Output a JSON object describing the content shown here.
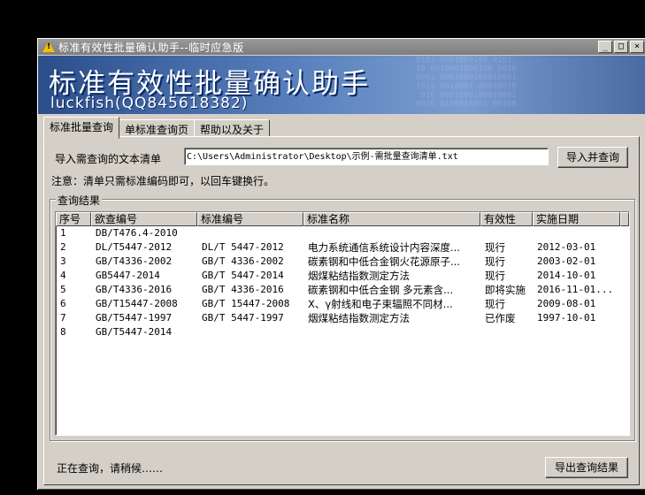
{
  "window": {
    "title": "标准有效性批量确认助手--临时应急版",
    "buttons": {
      "minimize": "_",
      "maximize": "□",
      "close": "×"
    }
  },
  "banner": {
    "title": "标准有效性批量确认助手",
    "subtitle": "luckfish(QQ845618382)"
  },
  "tabs": [
    {
      "label": "标准批量查询",
      "active": true
    },
    {
      "label": "单标准查询页",
      "active": false
    },
    {
      "label": "帮助以及关于",
      "active": false
    }
  ],
  "query": {
    "file_label": "导入需查询的文本清单",
    "file_path": "C:\\Users\\Administrator\\Desktop\\示例-需批量查询清单.txt",
    "import_button": "导入并查询",
    "note": "注意：清单只需标准编码即可，以回车键换行。"
  },
  "results": {
    "group_title": "查询结果",
    "columns": [
      "序号",
      "欲查编号",
      "标准编号",
      "标准名称",
      "有效性",
      "实施日期"
    ],
    "rows": [
      [
        "1",
        "DB/T476.4-2010",
        "",
        "",
        "",
        ""
      ],
      [
        "2",
        "DL/T5447-2012",
        "DL/T 5447-2012",
        "电力系统通信系统设计内容深度...",
        "现行",
        "2012-03-01"
      ],
      [
        "3",
        "GB/T4336-2002",
        "GB/T 4336-2002",
        "碳素钢和中低合金钢火花源原子...",
        "现行",
        "2003-02-01"
      ],
      [
        "4",
        "GB5447-2014",
        "GB/T 5447-2014",
        "烟煤粘结指数测定方法",
        "现行",
        "2014-10-01"
      ],
      [
        "5",
        "GB/T4336-2016",
        "GB/T 4336-2016",
        "碳素钢和中低合金钢 多元素含...",
        "即将实施",
        "2016-11-01..."
      ],
      [
        "6",
        "GB/T15447-2008",
        "GB/T 15447-2008",
        "X、γ射线和电子束辐照不同材...",
        "现行",
        "2009-08-01"
      ],
      [
        "7",
        "GB/T5447-1997",
        "GB/T 5447-1997",
        "烟煤粘结指数测定方法",
        "已作废",
        "1997-10-01"
      ],
      [
        "8",
        "GB/T5447-2014",
        "",
        "",
        "",
        ""
      ]
    ]
  },
  "status": {
    "text": "正在查询，请稍候……",
    "export_button": "导出查询结果"
  }
}
